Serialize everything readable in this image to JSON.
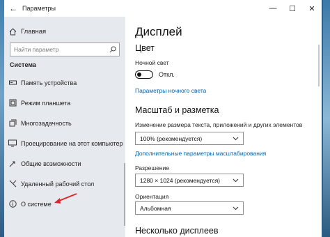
{
  "window": {
    "title": "Параметры",
    "back_glyph": "←",
    "minimize_glyph": "—",
    "maximize_glyph": "☐",
    "close_glyph": "✕"
  },
  "sidebar": {
    "home_label": "Главная",
    "search_placeholder": "Найти параметр",
    "section_title": "Система",
    "items": [
      {
        "label": "Память устройства",
        "icon": "storage-icon"
      },
      {
        "label": "Режим планшета",
        "icon": "tablet-icon"
      },
      {
        "label": "Многозадачность",
        "icon": "multitasking-icon"
      },
      {
        "label": "Проецирование на этот компьютер",
        "icon": "projecting-icon"
      },
      {
        "label": "Общие возможности",
        "icon": "shared-experiences-icon"
      },
      {
        "label": "Удаленный рабочий стол",
        "icon": "remote-desktop-icon"
      },
      {
        "label": "О системе",
        "icon": "info-icon"
      }
    ]
  },
  "main": {
    "title": "Дисплей",
    "color_heading": "Цвет",
    "night_light_label": "Ночной свет",
    "night_light_state": "Откл.",
    "night_light_settings_link": "Параметры ночного света",
    "scale_heading": "Масштаб и разметка",
    "scale_label": "Изменение размера текста, приложений и других элементов",
    "scale_value": "100% (рекомендуется)",
    "advanced_scaling_link": "Дополнительные параметры масштабирования",
    "resolution_label": "Разрешение",
    "resolution_value": "1280 × 1024 (рекомендуется)",
    "orientation_label": "Ориентация",
    "orientation_value": "Альбомная",
    "multiple_displays_heading": "Несколько дисплеев"
  },
  "colors": {
    "accent": "#0063b1",
    "sidebar_bg": "#e6eaee",
    "annotation_arrow": "#e0242b"
  }
}
